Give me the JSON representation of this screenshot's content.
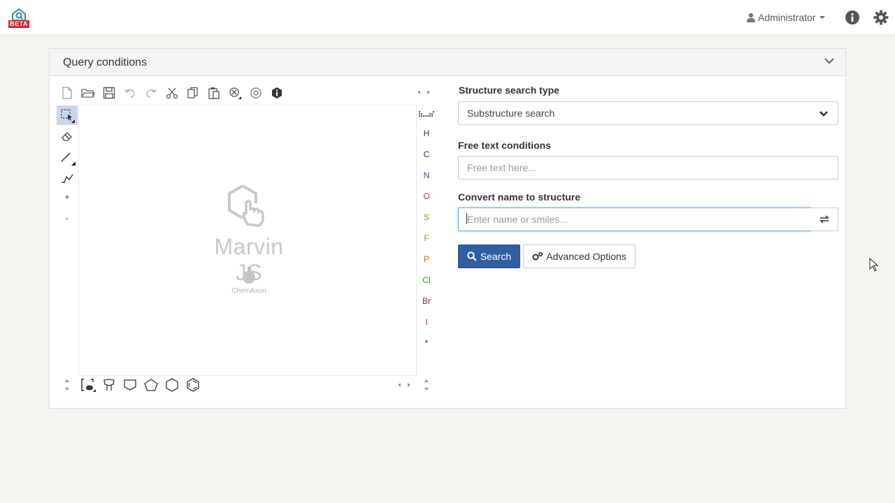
{
  "navbar": {
    "logo_badge": "BETA",
    "user_label": "Administrator",
    "icons": [
      "user-icon",
      "info-icon",
      "gear-icon"
    ]
  },
  "panel": {
    "title": "Query conditions"
  },
  "editor": {
    "brand": "Marvin JS",
    "brand_sub": "ChemAxon",
    "atoms": [
      {
        "symbol": "H",
        "color": "#333333"
      },
      {
        "symbol": "C",
        "color": "#333333"
      },
      {
        "symbol": "N",
        "color": "#2f4f9e"
      },
      {
        "symbol": "O",
        "color": "#d42a2a"
      },
      {
        "symbol": "S",
        "color": "#9a8a1a"
      },
      {
        "symbol": "F",
        "color": "#b8860b"
      },
      {
        "symbol": "P",
        "color": "#c07000"
      },
      {
        "symbol": "Cl",
        "color": "#1f9a1f"
      },
      {
        "symbol": "Br",
        "color": "#8b2a2a"
      },
      {
        "symbol": "I",
        "color": "#8b2a8b"
      },
      {
        "symbol": "*",
        "color": "#333333"
      }
    ],
    "charge_plus": "+",
    "charge_minus": "-"
  },
  "form": {
    "search_type_label": "Structure search type",
    "search_type_value": "Substructure search",
    "free_text_label": "Free text conditions",
    "free_text_placeholder": "Free text here...",
    "convert_label": "Convert name to structure",
    "convert_placeholder": "Enter name or smiles...",
    "search_button": "Search",
    "advanced_button": "Advanced Options"
  },
  "colors": {
    "primary": "#2f5f9e",
    "beta_badge": "#d9282f",
    "focus": "#66afe9"
  }
}
